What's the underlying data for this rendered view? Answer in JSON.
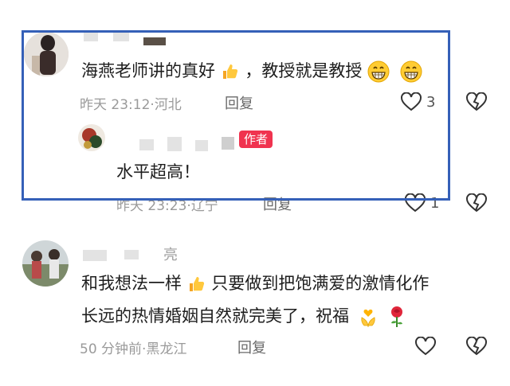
{
  "comments": [
    {
      "text_prefix": "海燕老师讲的真好",
      "text_suffix": "，教授就是教授",
      "time": "昨天 23:12",
      "separator": "·",
      "location": "河北",
      "reply_label": "回复",
      "like_count": "3",
      "reply": {
        "badge": "作者",
        "text": "水平超高！",
        "time": "昨天 23:23",
        "location": "辽宁",
        "reply_label": "回复",
        "like_count": "1"
      }
    },
    {
      "name_tail": "亮",
      "text_line1_prefix": "和我想法一样",
      "text_line1_suffix": "只要做到把饱满爱的激情化作",
      "text_line2": "长远的热情婚姻自然就完美了，祝福",
      "time": "50 分钟前",
      "separator": "·",
      "location": "黑龙江",
      "reply_label": "回复"
    }
  ],
  "icons": [
    "thumbs-up-icon",
    "grin-emoji-icon",
    "heart-icon",
    "broken-heart-icon",
    "hands-heart-icon",
    "rose-icon"
  ],
  "colors": {
    "highlight": "#3560b8",
    "badge": "#f0334f"
  }
}
